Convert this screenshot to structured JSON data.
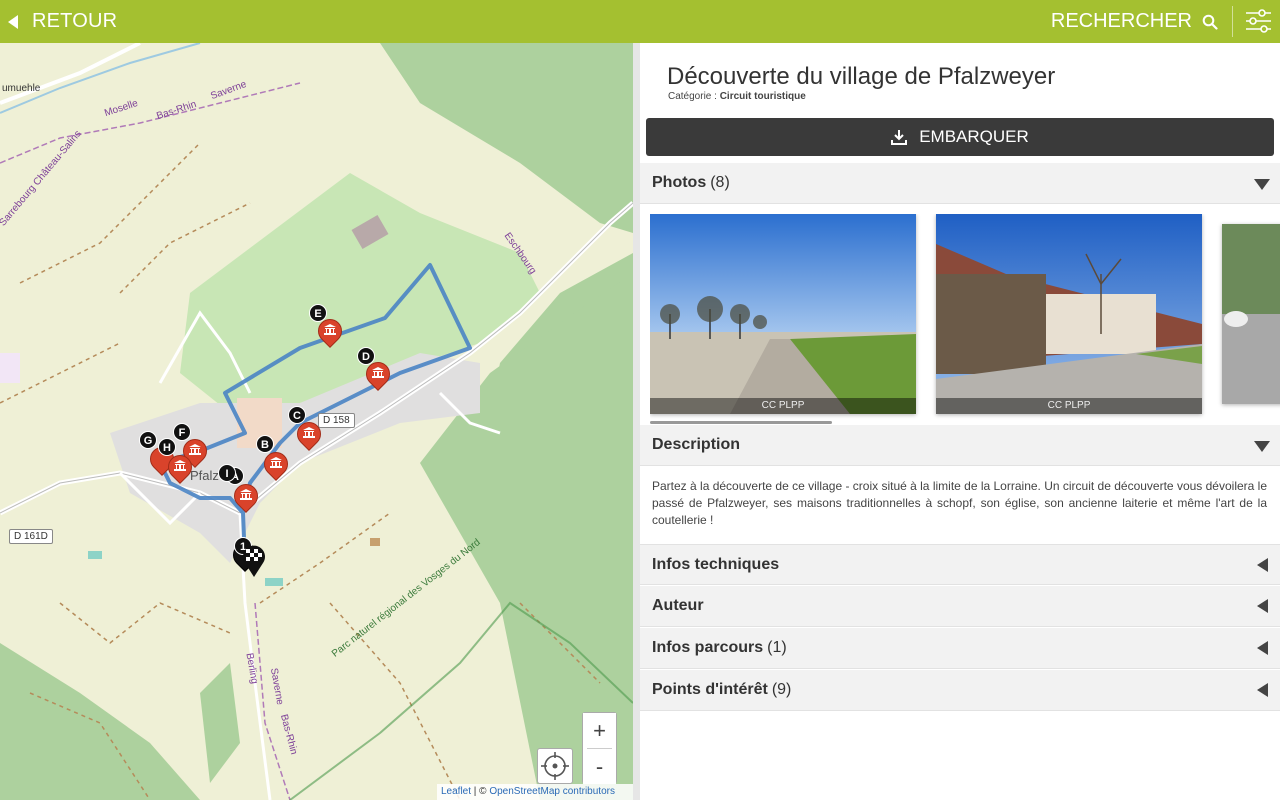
{
  "topbar": {
    "back_label": "RETOUR",
    "search_label": "RECHERCHER",
    "color": "#a4c030"
  },
  "map": {
    "road_labels": [
      "D 161D",
      "D 158"
    ],
    "place_labels": [
      "umuehle",
      "Moselle",
      "Bas-Rhin",
      "Saverne",
      "Sarrebourg Château-Salins",
      "Eschbourg",
      "Pfalz",
      "Berling",
      "Saverne",
      "Bas-Rhin"
    ],
    "park_label": "Parc naturel régional des Vosges du Nord",
    "markers": [
      "A",
      "B",
      "C",
      "D",
      "E",
      "F",
      "G",
      "H",
      "I"
    ],
    "start_label": "1",
    "zoom_in": "+",
    "zoom_out": "-",
    "attribution": {
      "leaflet": "Leaflet",
      "sep": " | © ",
      "osm": "OpenStreetMap contributors"
    },
    "route_color": "#4a84c4"
  },
  "panel": {
    "title": "Découverte du village de Pfalzweyer",
    "category_label": "Catégorie : ",
    "category_value": "Circuit touristique",
    "embark_label": "EMBARQUER",
    "photos": {
      "label": "Photos",
      "count": "(8)",
      "items": [
        {
          "caption": "CC PLPP"
        },
        {
          "caption": "CC PLPP"
        },
        {
          "caption": ""
        }
      ]
    },
    "description": {
      "label": "Description",
      "text": "Partez à la découverte de ce village - croix situé à la limite de la Lorraine. Un circuit de découverte vous dévoilera le passé de Pfalzweyer, ses maisons traditionnelles à schopf, son église, son ancienne laiterie et même l'art de la coutellerie !"
    },
    "sections": [
      {
        "label": "Infos techniques",
        "count": ""
      },
      {
        "label": "Auteur",
        "count": ""
      },
      {
        "label": "Infos parcours",
        "count": "(1)"
      },
      {
        "label": "Points d'intérêt",
        "count": "(9)"
      }
    ]
  }
}
